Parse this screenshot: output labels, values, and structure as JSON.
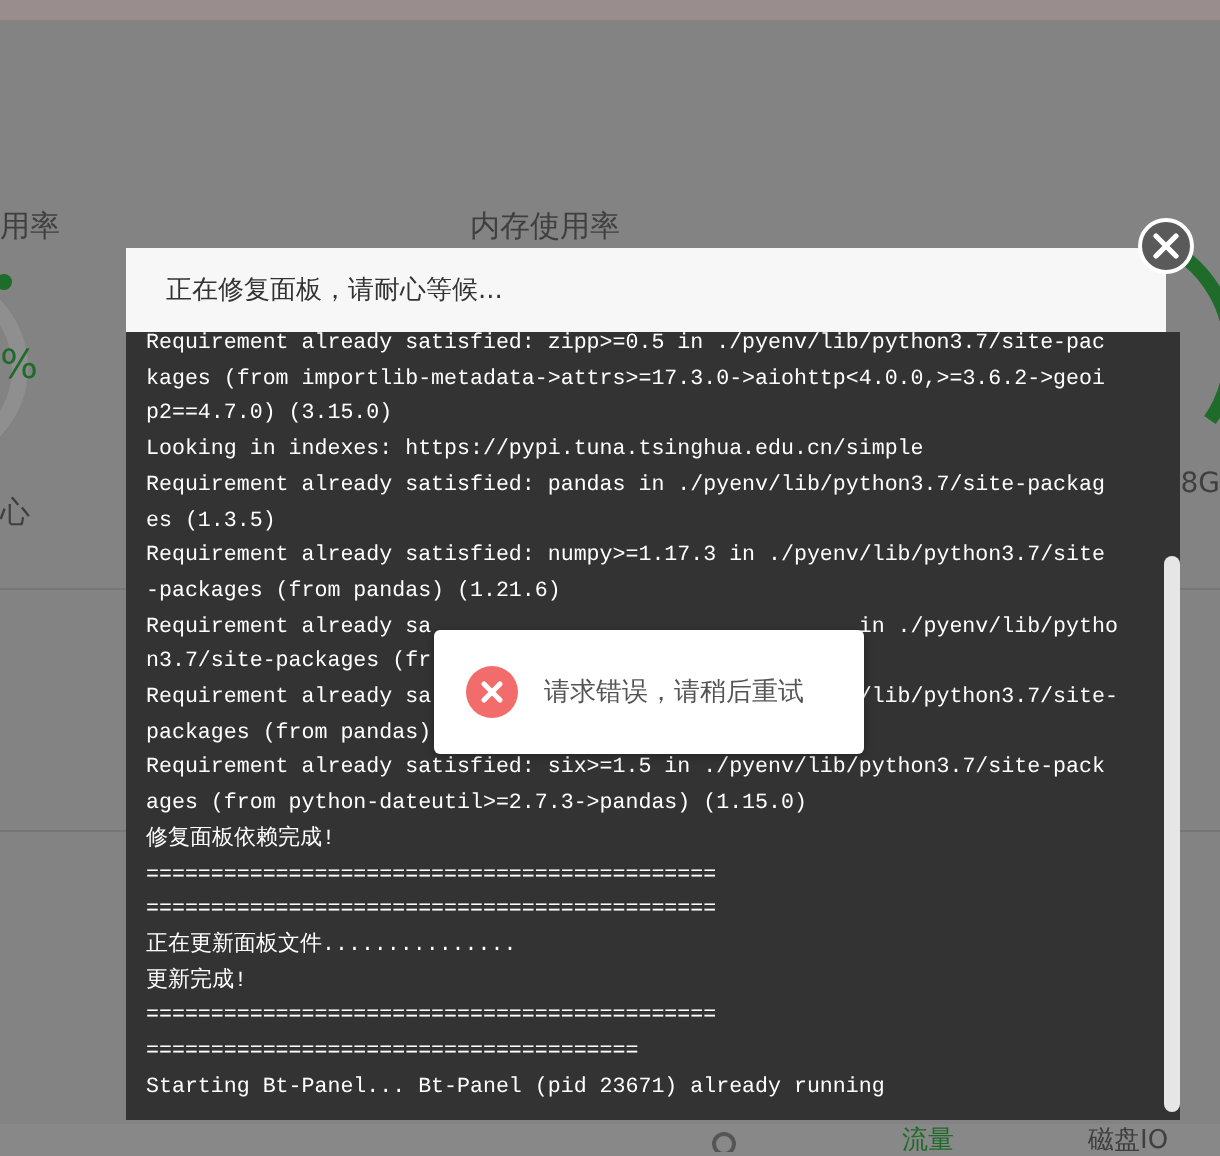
{
  "background": {
    "cpu_label": "用率",
    "cpu_value": "%",
    "cpu_note": "心",
    "memory_label": "内存使用率",
    "disk_note": "8G",
    "tabs": [
      {
        "label": "流量",
        "selected": true
      },
      {
        "label": "磁盘IO",
        "selected": false
      }
    ]
  },
  "dialog": {
    "title": "正在修复面板，请耐心等候...",
    "log": [
      {
        "segments": [
          "Requirement already satisfied: zipp>=0.5 in ./pyenv/lib/python3.7/site-pac"
        ]
      },
      {
        "segments": [
          "kages (from importlib-metadata->attrs>=17.3.0->aiohttp<4.0.0,>=3.6.2->geoi"
        ]
      },
      {
        "segments": [
          "p2==4.7.0) (3.15.0)"
        ]
      },
      {
        "segments": [
          "Looking in indexes: https://pypi.tuna.tsinghua.edu.cn/simple"
        ]
      },
      {
        "segments": [
          "Requirement already satisfied: pandas in ./pyenv/lib/python3.7/site-packag"
        ]
      },
      {
        "segments": [
          "es (1.3.5)"
        ]
      },
      {
        "segments": [
          "Requirement already satisfied: numpy>=1.17.3 in ./pyenv/lib/python3.7/site"
        ]
      },
      {
        "segments": [
          "-packages (from pandas) (1.21.6)"
        ]
      },
      {
        "segments": [
          "Requirement already sa",
          "in ./pyenv/lib/pytho"
        ]
      },
      {
        "segments": [
          "n3.7/site-packages (fr"
        ]
      },
      {
        "segments": [
          "Requirement already sa",
          "/lib/python3.7/site-"
        ]
      },
      {
        "segments": [
          "packages (from pandas)"
        ]
      },
      {
        "segments": [
          "Requirement already satisfied: six>=1.5 in ./pyenv/lib/python3.7/site-pack"
        ]
      },
      {
        "segments": [
          "ages (from python-dateutil>=2.7.3->pandas) (1.15.0)"
        ]
      },
      {
        "segments": [
          "修复面板依赖完成!"
        ]
      },
      {
        "segments": [
          "============================================"
        ]
      },
      {
        "segments": [
          "============================================"
        ]
      },
      {
        "segments": [
          "正在更新面板文件..............."
        ]
      },
      {
        "segments": [
          "更新完成!"
        ]
      },
      {
        "segments": [
          "============================================"
        ]
      },
      {
        "segments": [
          "======================================"
        ]
      },
      {
        "segments": [
          "Starting Bt-Panel... Bt-Panel (pid 23671) already running"
        ]
      }
    ]
  },
  "toast": {
    "kind": "error",
    "message": "请求错误，请稍后重试"
  }
}
